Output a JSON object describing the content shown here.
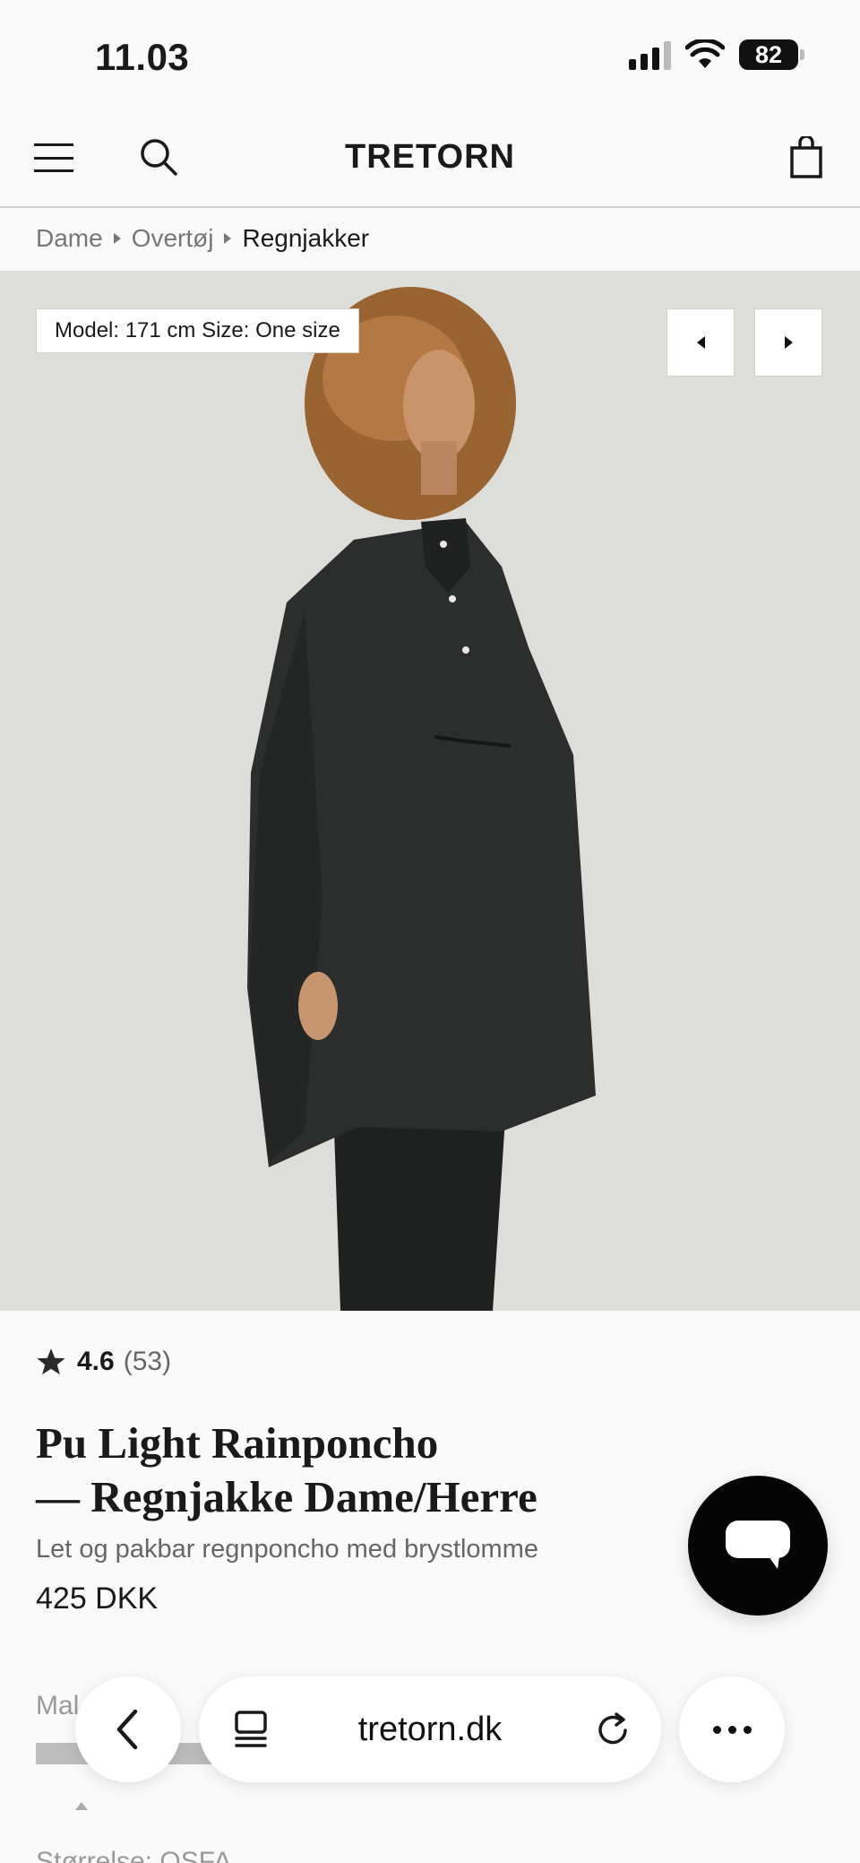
{
  "status_bar": {
    "time": "11.03",
    "battery": "82"
  },
  "header": {
    "brand": "TRETORN"
  },
  "breadcrumb": {
    "items": [
      "Dame",
      "Overtøj",
      "Regnjakker"
    ]
  },
  "gallery": {
    "model_info": "Model: 171 cm Size: One size"
  },
  "product": {
    "rating": "4.6",
    "review_count": "(53)",
    "title_line1": "Pu Light Rainponcho",
    "title_line2": "— Regnjakke Dame/Herre",
    "subtitle": "Let og pakbar regnponcho med brystlomme",
    "price": "425 DKK"
  },
  "below_fold": {
    "color_label": "Mal",
    "size_label": "Størrelse: OSFA"
  },
  "browser": {
    "url": "tretorn.dk"
  },
  "colors": {
    "accent": "#1a1a1a",
    "gallery_bg": "#ddddda",
    "chat_fab": "#050505"
  },
  "icons": {
    "menu": "hamburger-icon",
    "search": "search-icon",
    "cart": "shopping-bag-icon",
    "chat": "chat-bubble-icon",
    "back": "chevron-left-icon",
    "tabs": "tabs-icon",
    "reload": "reload-icon",
    "more": "more-icon"
  }
}
